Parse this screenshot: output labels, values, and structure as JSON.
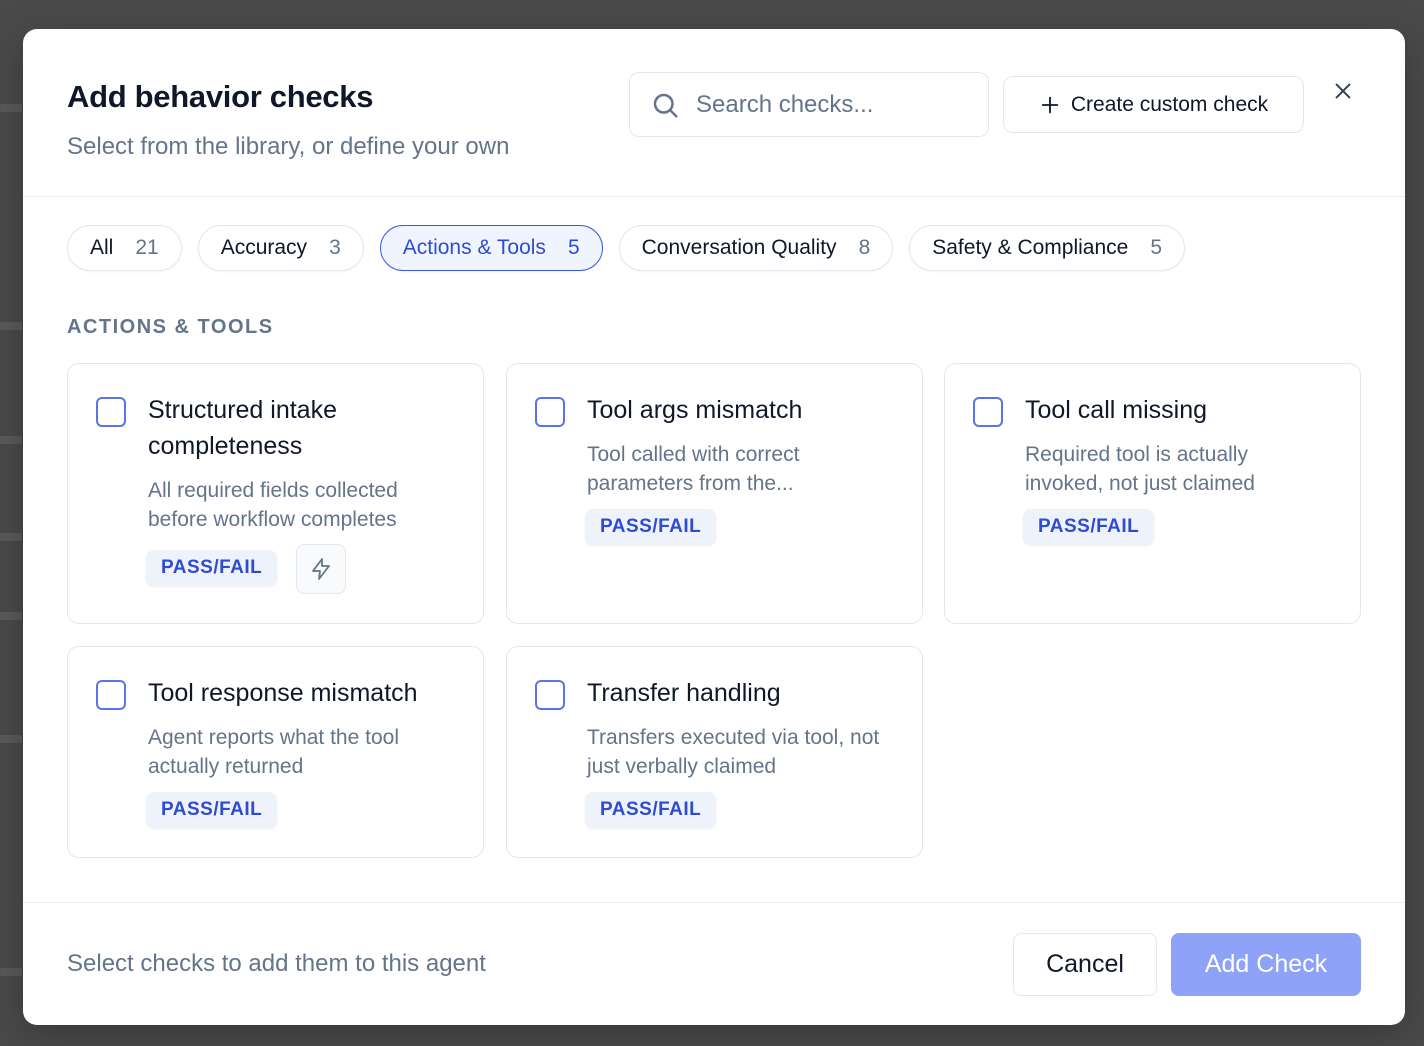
{
  "header": {
    "title": "Add behavior checks",
    "subtitle": "Select from the library, or define your own",
    "search_placeholder": "Search checks...",
    "create_label": "Create custom check",
    "icons": {
      "search": "search-icon",
      "plus": "plus-icon",
      "close": "close-icon"
    }
  },
  "tabs": [
    {
      "label": "All",
      "count": "21",
      "active": false
    },
    {
      "label": "Accuracy",
      "count": "3",
      "active": false
    },
    {
      "label": "Actions & Tools",
      "count": "5",
      "active": true
    },
    {
      "label": "Conversation Quality",
      "count": "8",
      "active": false
    },
    {
      "label": "Safety & Compliance",
      "count": "5",
      "active": false
    }
  ],
  "section_label": "ACTIONS & TOOLS",
  "checks": [
    {
      "title": "Structured intake completeness",
      "description": "All required fields collected before workflow completes",
      "badge": "PASS/FAIL",
      "checked": false,
      "has_bolt": true
    },
    {
      "title": "Tool args mismatch",
      "description": "Tool called with correct parameters from the...",
      "badge": "PASS/FAIL",
      "checked": false,
      "has_bolt": false
    },
    {
      "title": "Tool call missing",
      "description": "Required tool is actually invoked, not just claimed",
      "badge": "PASS/FAIL",
      "checked": false,
      "has_bolt": false
    },
    {
      "title": "Tool response mismatch",
      "description": "Agent reports what the tool actually returned",
      "badge": "PASS/FAIL",
      "checked": false,
      "has_bolt": false
    },
    {
      "title": "Transfer handling",
      "description": "Transfers executed via tool, not just verbally claimed",
      "badge": "PASS/FAIL",
      "checked": false,
      "has_bolt": false
    }
  ],
  "footer": {
    "hint": "Select checks to add them to this agent",
    "cancel_label": "Cancel",
    "add_label": "Add Check"
  },
  "colors": {
    "accent": "#2f4bd1",
    "primary_disabled": "#8ea2f8",
    "muted_text": "#64748b",
    "text": "#0f172a",
    "backdrop": "#4a4a4a"
  }
}
